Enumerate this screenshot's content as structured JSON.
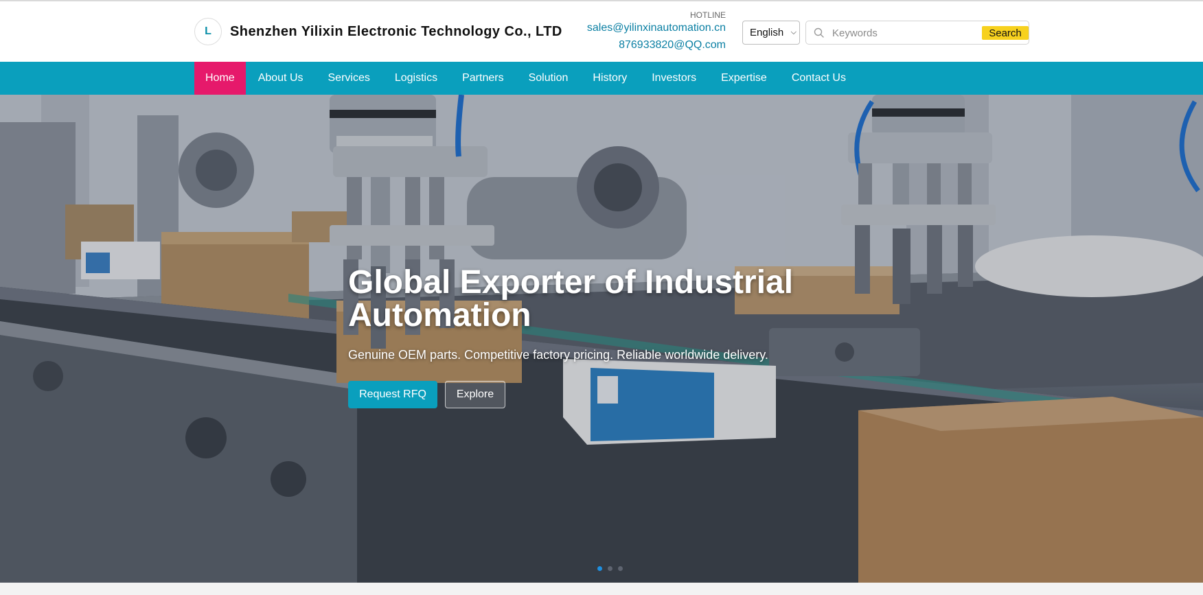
{
  "header": {
    "logo_letter": "L",
    "company_name": "Shenzhen Yilixin Electronic Technology Co., LTD",
    "hotline_label": "HOTLINE",
    "email": "sales@yilinxinautomation.cn",
    "qq": "876933820@QQ.com",
    "language": {
      "selected": "English"
    },
    "search": {
      "placeholder": "Keywords",
      "button_label": "Search"
    }
  },
  "nav": {
    "items": [
      {
        "label": "Home",
        "active": true
      },
      {
        "label": "About Us"
      },
      {
        "label": "Services"
      },
      {
        "label": "Logistics"
      },
      {
        "label": "Partners"
      },
      {
        "label": "Solution"
      },
      {
        "label": "History"
      },
      {
        "label": "Investors"
      },
      {
        "label": "Expertise"
      },
      {
        "label": "Contact Us"
      }
    ]
  },
  "hero": {
    "title": "Global Exporter of Industrial Automation",
    "subtitle": "Genuine OEM parts. Competitive factory pricing. Reliable worldwide delivery.",
    "primary_button": "Request RFQ",
    "secondary_button": "Explore",
    "slides_count": 3,
    "active_slide": 1
  },
  "colors": {
    "nav_bg": "#0a9fbd",
    "nav_active": "#e6196b",
    "link": "#0a7fa3",
    "search_button": "#f7d11e",
    "dot_active": "#1e8fe0"
  }
}
